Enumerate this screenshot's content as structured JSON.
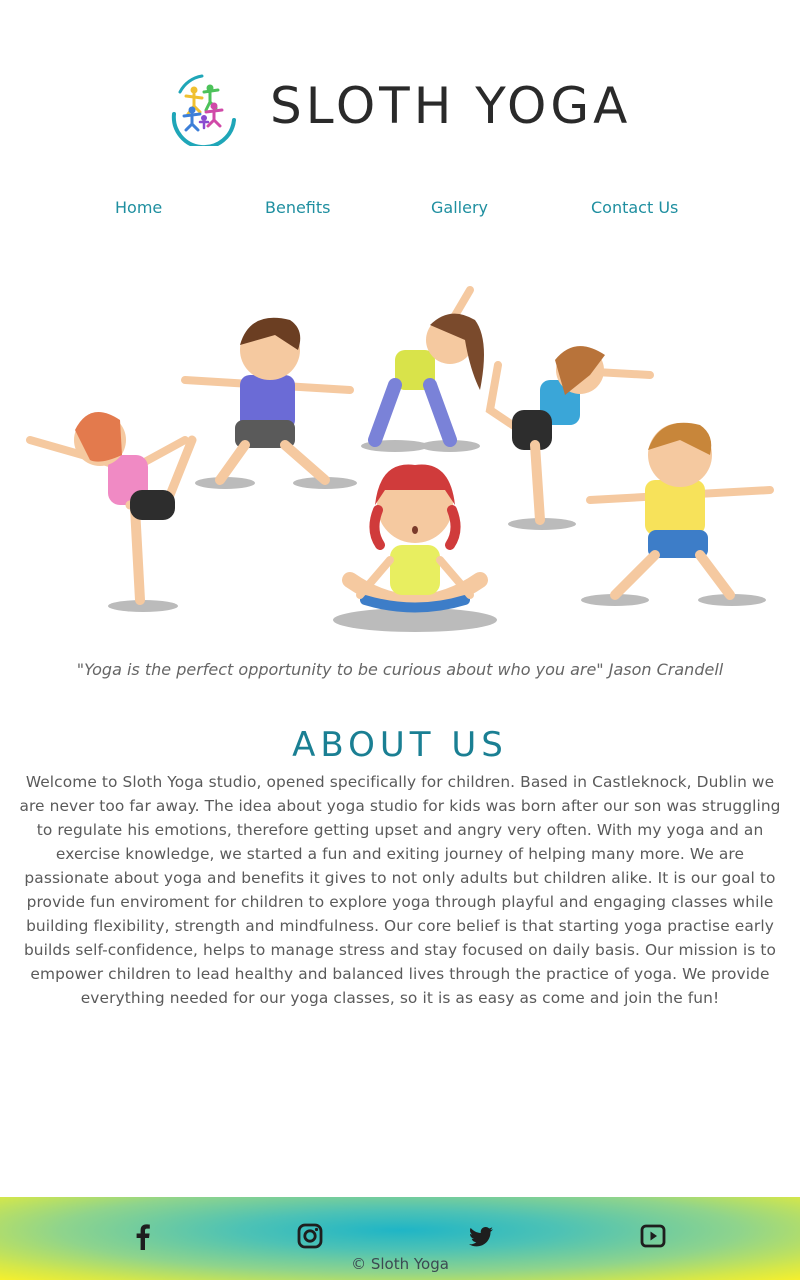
{
  "header": {
    "brand": "SLOTH YOGA",
    "logo_icon": "children-yoga-logo-icon"
  },
  "nav": {
    "items": [
      {
        "label": "Home"
      },
      {
        "label": "Benefits"
      },
      {
        "label": "Gallery"
      },
      {
        "label": "Contact Us"
      }
    ],
    "color": "#1f8fa0"
  },
  "hero": {
    "image": "kids-doing-yoga-illustration"
  },
  "quote": "\"Yoga is the perfect opportunity to be curious about who you are\" Jason Crandell",
  "about": {
    "title": "ABOUT US",
    "body": "Welcome to Sloth Yoga studio, opened specifically for children. Based in Castleknock, Dublin we are never too far away. The idea about yoga studio for kids was born after our son was struggling to regulate his emotions, therefore getting upset and angry very often. With my yoga and an exercise knowledge, we started a fun and exiting journey of helping many more. We are passionate about yoga and benefits it gives to not only adults but children alike. It is our goal to provide fun enviroment for children to explore yoga through playful and engaging classes while building flexibility, strength and mindfulness. Our core belief is that starting yoga practise early builds self-confidence, helps to manage stress and stay focused on daily basis. Our mission is to empower children to lead healthy and balanced lives through the practice of yoga. We provide everything needed for our yoga classes, so it is as easy as come and join the fun!",
    "title_color": "#1a7f93"
  },
  "footer": {
    "social": [
      "facebook-icon",
      "instagram-icon",
      "twitter-icon",
      "youtube-icon"
    ],
    "copyright": "© Sloth Yoga"
  }
}
